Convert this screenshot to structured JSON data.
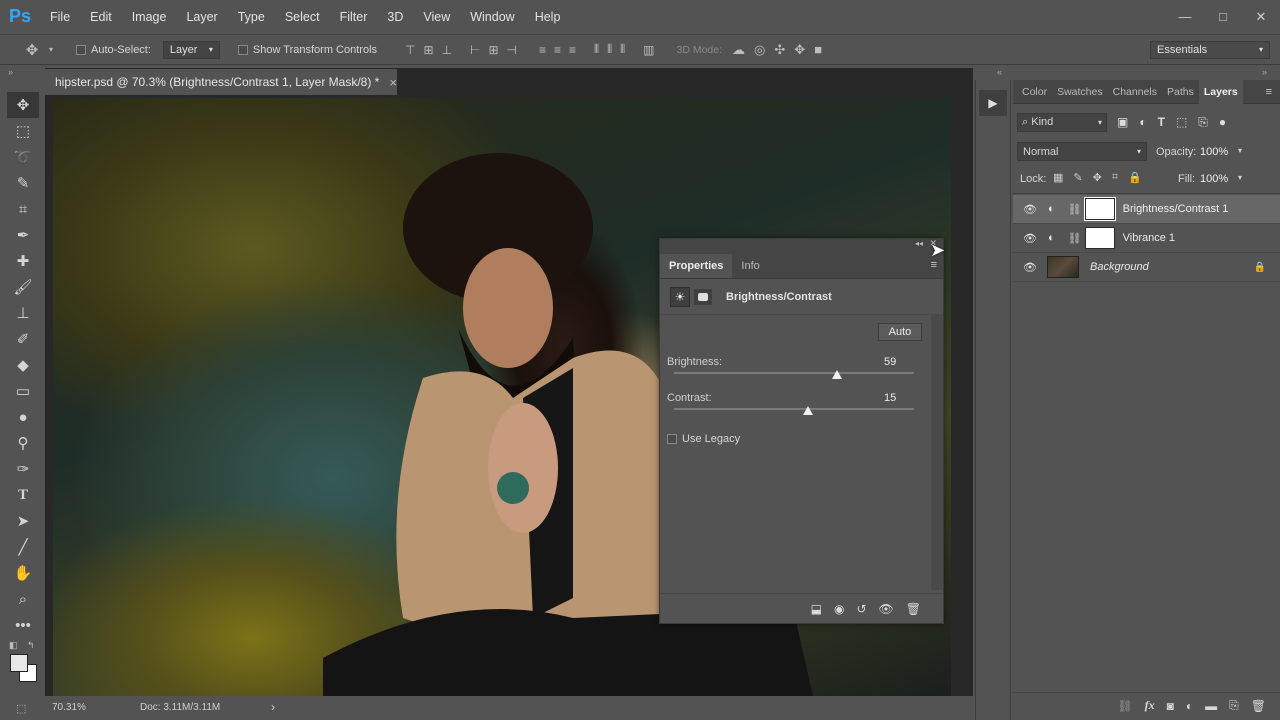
{
  "menubar": {
    "logo": "Ps",
    "items": [
      "File",
      "Edit",
      "Image",
      "Layer",
      "Type",
      "Select",
      "Filter",
      "3D",
      "View",
      "Window",
      "Help"
    ],
    "window_controls": {
      "minimize": "—",
      "maximize": "□",
      "close": "✕"
    }
  },
  "options_bar": {
    "auto_select_label": "Auto-Select:",
    "auto_select_value": "Layer",
    "show_transform_label": "Show Transform Controls",
    "mode_3d_label": "3D Mode:",
    "workspace": "Essentials"
  },
  "document": {
    "tab_title": "hipster.psd @ 70.3% (Brightness/Contrast 1, Layer Mask/8) *",
    "close": "×"
  },
  "status": {
    "zoom": "70.31%",
    "doc_info": "Doc: 3.11M/3.11M",
    "arrow": "›"
  },
  "properties": {
    "tabs": [
      "Properties",
      "Info"
    ],
    "adjustment_name": "Brightness/Contrast",
    "auto_button": "Auto",
    "brightness": {
      "label": "Brightness:",
      "value": "59",
      "fraction": 0.68
    },
    "contrast": {
      "label": "Contrast:",
      "value": "15",
      "fraction": 0.56
    },
    "use_legacy_label": "Use Legacy"
  },
  "layers_panel": {
    "tabs": [
      "Color",
      "Swatches",
      "Channels",
      "Paths",
      "Layers"
    ],
    "filter_kind": "Kind",
    "blend_mode": "Normal",
    "opacity_label": "Opacity:",
    "opacity_value": "100%",
    "lock_label": "Lock:",
    "fill_label": "Fill:",
    "fill_value": "100%",
    "layers": [
      {
        "name": "Brightness/Contrast 1",
        "active": true
      },
      {
        "name": "Vibrance 1",
        "active": false
      },
      {
        "name": "Background",
        "active": false
      }
    ],
    "bottom_icons": [
      "link-icon",
      "fx-icon",
      "mask-icon",
      "adjustment-icon",
      "folder-icon",
      "new-layer-icon",
      "trash-icon"
    ],
    "fx_label": "fx"
  },
  "colors": {
    "ui_bg": "#535353",
    "accent_blue": "#31a8ff"
  }
}
